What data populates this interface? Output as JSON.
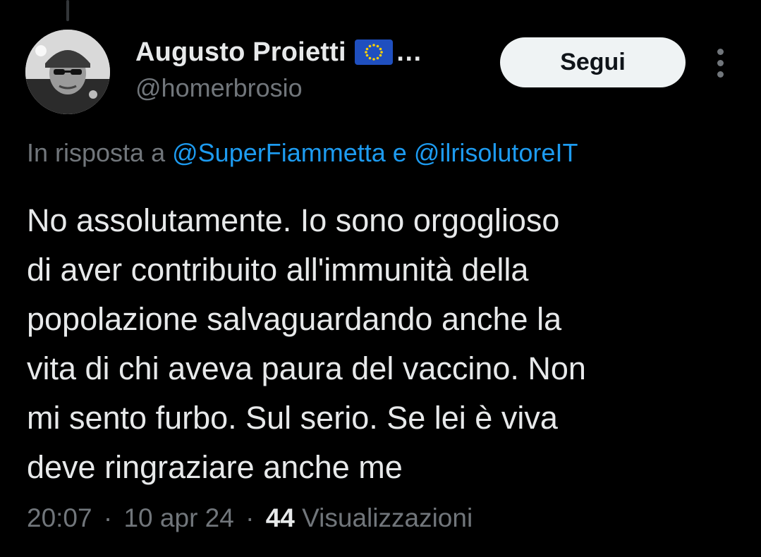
{
  "author": {
    "display_name": "Augusto Proietti",
    "flag_icon": "eu-flag-icon",
    "truncation": "…",
    "handle": "@homerbrosio"
  },
  "actions": {
    "follow_label": "Segui",
    "more_icon": "more-vertical-icon"
  },
  "reply_context": {
    "prefix": "In risposta a",
    "mention_1": "@SuperFiammetta",
    "conjunction": "e",
    "mention_2": "@ilrisolutoreIT"
  },
  "tweet": {
    "lines": [
      "No assolutamente. Io sono orgoglioso",
      "di aver contribuito all'immunità della",
      "popolazione salvaguardando anche la",
      "vita di chi aveva paura del vaccino. Non",
      "mi sento furbo. Sul serio. Se lei è viva",
      "deve ringraziare anche me"
    ]
  },
  "meta": {
    "time": "20:07",
    "separator": "·",
    "date": "10 apr 24",
    "views_count": "44",
    "views_label": "Visualizzazioni"
  },
  "colors": {
    "background": "#000000",
    "text_primary": "#e7e9ea",
    "text_secondary": "#71767b",
    "link": "#1d9bf0",
    "follow_button_bg": "#eff3f4"
  }
}
